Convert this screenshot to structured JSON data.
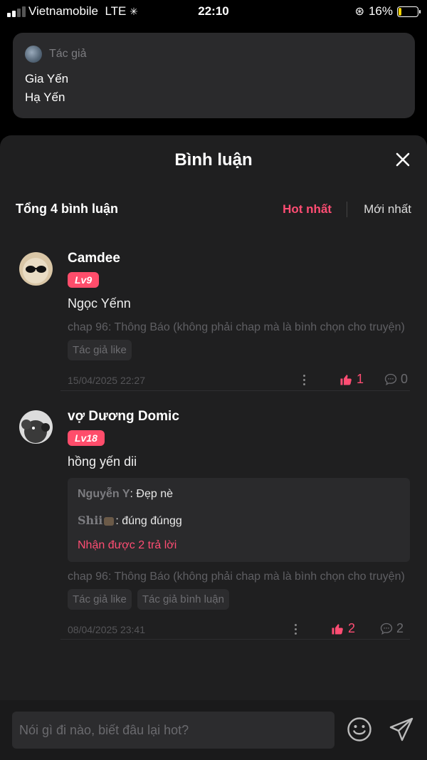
{
  "status_bar": {
    "carrier": "Vietnamobile",
    "network": "LTE",
    "time": "22:10",
    "battery": "16%",
    "battery_level": 0.16
  },
  "author_card": {
    "label": "Tác giả",
    "names": [
      "Gia Yến",
      "Hạ Yến"
    ]
  },
  "sheet": {
    "title": "Bình luận",
    "total": "Tổng 4 bình luận",
    "sort_hot": "Hot nhất",
    "sort_new": "Mới nhất"
  },
  "comments": [
    {
      "name": "Camdee",
      "level": "Lv9",
      "text": "Ngọc Yếnn",
      "chapter": "chap 96: Thông Báo (không phải chap mà là bình chọn cho truyện)",
      "tags": [
        "Tác giả like"
      ],
      "date": "15/04/2025 22:27",
      "likes": "1",
      "replies": "0"
    },
    {
      "name": "vợ Dương Domic",
      "level": "Lv18",
      "text": "hồng yến dii",
      "reply_preview": [
        {
          "name": "Nguyễn Y",
          "text": ": Đẹp nè"
        },
        {
          "name": "Shii",
          "text": ": đúng đúngg"
        }
      ],
      "reply_more": "Nhận được 2 trả lời",
      "chapter": "chap 96: Thông Báo (không phải chap mà là bình chọn cho truyện)",
      "tags": [
        "Tác giả like",
        "Tác giả bình luận"
      ],
      "date": "08/04/2025 23:41",
      "likes": "2",
      "replies": "2"
    }
  ],
  "input": {
    "placeholder": "Nói gì đi nào, biết đâu lại hot?"
  },
  "colors": {
    "accent": "#ff4d73",
    "level_badge": "#ff4d6b",
    "sheet_bg": "#1f1f20",
    "card_bg": "#2a2a2c"
  }
}
